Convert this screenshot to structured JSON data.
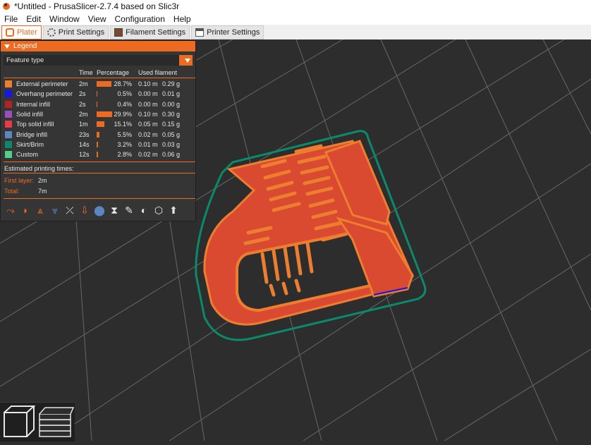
{
  "window": {
    "title": "*Untitled - PrusaSlicer-2.7.4 based on Slic3r"
  },
  "menu": [
    "File",
    "Edit",
    "Window",
    "View",
    "Configuration",
    "Help"
  ],
  "tabs": [
    {
      "label": "Plater",
      "active": true
    },
    {
      "label": "Print Settings",
      "active": false
    },
    {
      "label": "Filament Settings",
      "active": false
    },
    {
      "label": "Printer Settings",
      "active": false
    }
  ],
  "legend": {
    "title": "Legend",
    "view_type": "Feature type",
    "columns": {
      "time": "Time",
      "percentage": "Percentage",
      "used_filament": "Used filament"
    },
    "features": [
      {
        "name": "External perimeter",
        "color": "#ED7E2F",
        "time": "2m",
        "percent": "28.7%",
        "percent_value": 28.7,
        "length": "0.10 m",
        "weight": "0.29 g"
      },
      {
        "name": "Overhang perimeter",
        "color": "#1616E8",
        "time": "2s",
        "percent": "0.5%",
        "percent_value": 0.5,
        "length": "0.00 m",
        "weight": "0.01 g"
      },
      {
        "name": "Internal infill",
        "color": "#B22424",
        "time": "2s",
        "percent": "0.4%",
        "percent_value": 0.4,
        "length": "0.00 m",
        "weight": "0.00 g"
      },
      {
        "name": "Solid infill",
        "color": "#9A4FC1",
        "time": "2m",
        "percent": "29.9%",
        "percent_value": 29.9,
        "length": "0.10 m",
        "weight": "0.30 g"
      },
      {
        "name": "Top solid infill",
        "color": "#EC3A45",
        "time": "1m",
        "percent": "15.1%",
        "percent_value": 15.1,
        "length": "0.05 m",
        "weight": "0.15 g"
      },
      {
        "name": "Bridge infill",
        "color": "#5B86C2",
        "time": "23s",
        "percent": "5.5%",
        "percent_value": 5.5,
        "length": "0.02 m",
        "weight": "0.05 g"
      },
      {
        "name": "Skirt/Brim",
        "color": "#0A8A6A",
        "time": "14s",
        "percent": "3.2%",
        "percent_value": 3.2,
        "length": "0.01 m",
        "weight": "0.03 g"
      },
      {
        "name": "Custom",
        "color": "#4FD08A",
        "time": "12s",
        "percent": "2.8%",
        "percent_value": 2.8,
        "length": "0.02 m",
        "weight": "0.06 g"
      }
    ],
    "estimated_label": "Estimated printing times:",
    "first_layer_label": "First layer:",
    "first_layer_value": "2m",
    "total_label": "Total:",
    "total_value": "7m",
    "toolbar_icons": [
      "travel-icon",
      "wipe-icon",
      "retractions-icon",
      "deretractions-icon",
      "seams-icon",
      "tool-changes-icon",
      "color-changes-icon",
      "pause-prints-icon",
      "custom-gcode-icon",
      "center-of-gravity-icon",
      "shells-icon",
      "tool-marker-icon"
    ]
  },
  "view_controls": [
    "3d-view-icon",
    "layers-view-icon"
  ],
  "accent": "#ED6B21"
}
